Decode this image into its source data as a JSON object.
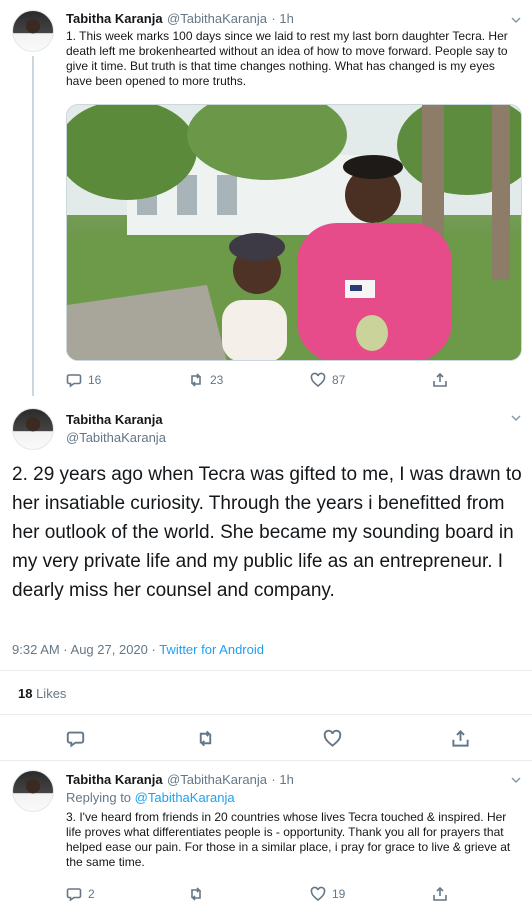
{
  "tweet1": {
    "name": "Tabitha Karanja",
    "handle": "@TabithaKaranja",
    "time": "· 1h",
    "text": "1. This week marks 100 days since we laid to rest my last born daughter Tecra. Her death left me brokenhearted without an idea of how to move forward. People say to give it time. But truth is that time changes nothing. What has changed is my eyes have been opened to more truths.",
    "replies": "16",
    "retweets": "23",
    "likes": "87"
  },
  "tweet2": {
    "name": "Tabitha Karanja",
    "handle": "@TabithaKaranja",
    "text": "2. 29 years ago when Tecra was gifted to me, I was drawn to her insatiable curiosity. Through the years i benefitted from her outlook of the world. She became my sounding board in my very private life and my public life as an entrepreneur. I dearly miss her counsel and company.",
    "timestamp": "9:32 AM · Aug 27, 2020 · ",
    "source": "Twitter for Android",
    "likes_count": "18",
    "likes_label": " Likes"
  },
  "tweet3": {
    "name": "Tabitha Karanja",
    "handle": "@TabithaKaranja",
    "time": "· 1h",
    "replying_prefix": "Replying to ",
    "replying_to": "@TabithaKaranja",
    "text": "3. I've heard from friends in 20 countries whose lives Tecra touched & inspired. Her life proves what differentiates people is - opportunity. Thank you all for prayers that helped ease our pain. For those in a similar place, i pray for grace to live & grieve at the same time.",
    "replies": "2",
    "retweets": "",
    "likes": "19"
  },
  "icons": {
    "reply": "reply-icon",
    "retweet": "retweet-icon",
    "like": "heart-icon",
    "share": "share-icon",
    "more": "chevron-down-icon"
  }
}
